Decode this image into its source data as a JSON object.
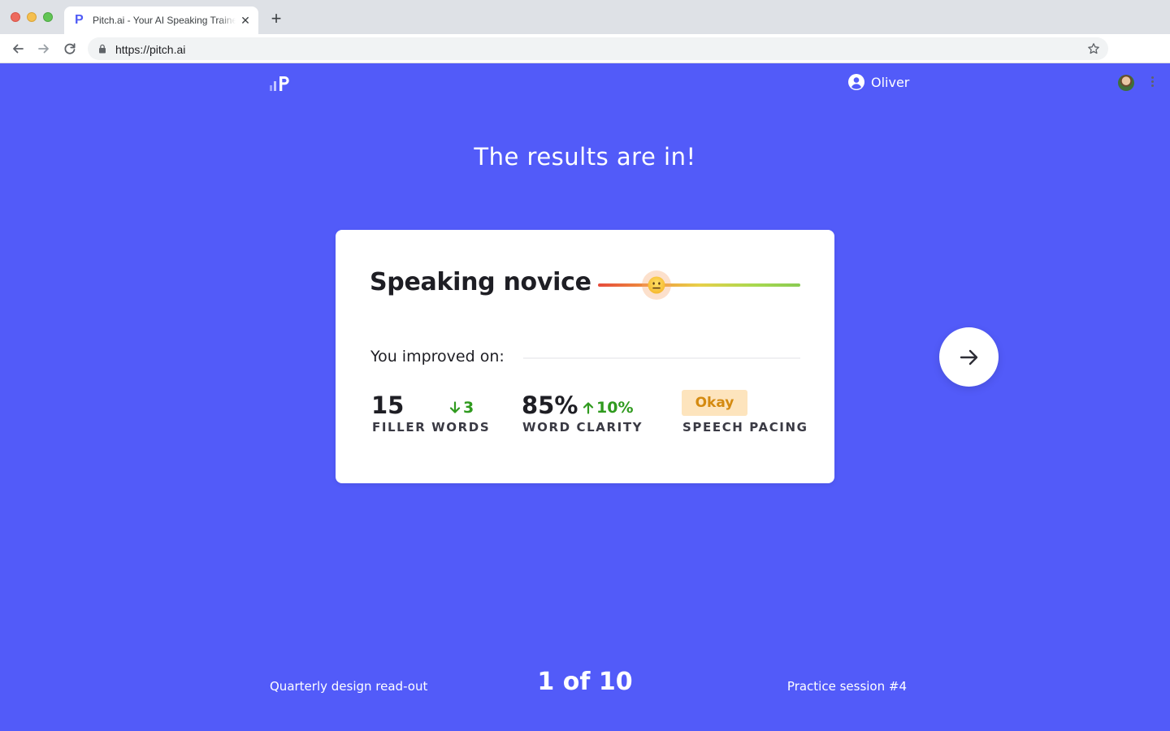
{
  "browser": {
    "tab_title": "Pitch.ai - Your AI Speaking Trainer",
    "tab_favicon": "P",
    "tab_close": "✕",
    "new_tab": "+",
    "url": "https://pitch.ai"
  },
  "header": {
    "logo_icon": "pitch-logo-icon",
    "user_name": "Oliver"
  },
  "headline": "The results are in!",
  "result_card": {
    "rank_title": "Speaking novice",
    "skill_meter_level": 0.29,
    "meter_colors": [
      "#e64b3c",
      "#f09a3e",
      "#e8d04a",
      "#8acb52"
    ],
    "improved_label": "You improved on:",
    "stats": [
      {
        "value": "15",
        "delta": "3",
        "delta_direction": "down",
        "label": "FILLER WORDS"
      },
      {
        "value": "85%",
        "delta": "10%",
        "delta_direction": "up",
        "label": "WORD CLARITY"
      },
      {
        "badge": "Okay",
        "label": "SPEECH PACING"
      }
    ]
  },
  "footer": {
    "presentation_name": "Quarterly design read-out",
    "progress": "1 of 10",
    "session": "Practice session #4"
  },
  "colors": {
    "background": "#525bf9",
    "positive": "#2f9a1e",
    "badge_bg": "#fde4bd",
    "badge_text": "#d48a10"
  }
}
